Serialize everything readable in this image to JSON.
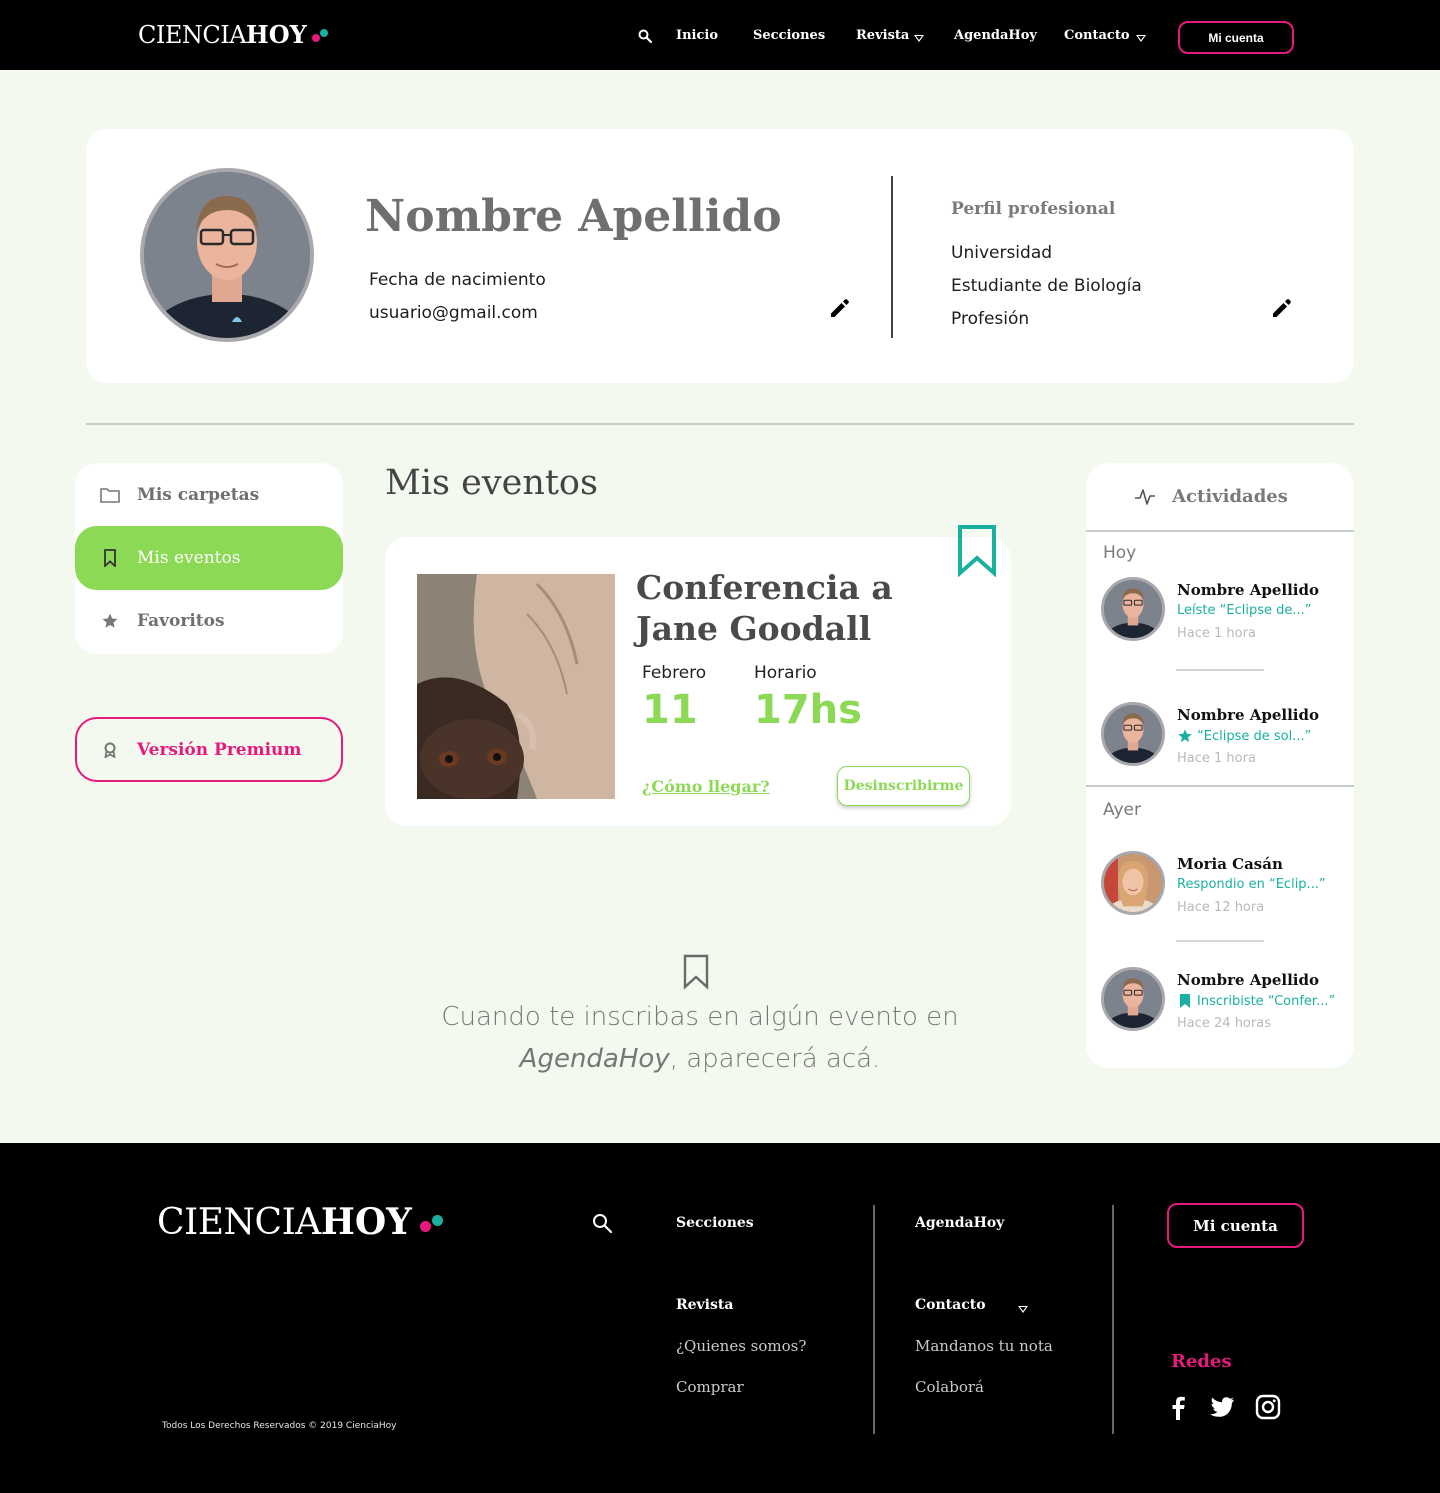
{
  "brand": {
    "name_light": "CIENCIA",
    "name_bold": "HOY",
    "colors": {
      "pink": "#e8197d",
      "teal": "#1ab0a0",
      "green": "#8cd955"
    }
  },
  "header": {
    "nav": [
      "Inicio",
      "Secciones",
      "Revista",
      "AgendaHoy",
      "Contacto"
    ],
    "account_button": "Mi cuenta",
    "icons": {
      "search": "search-icon",
      "dropdown": "triangle-down-icon"
    }
  },
  "profile": {
    "name": "Nombre Apellido",
    "birthdate": "Fecha de nacimiento",
    "email": "usuario@gmail.com",
    "pro_title": "Perfil profesional",
    "pro_lines": [
      "Universidad",
      "Estudiante de Biología",
      "Profesión"
    ]
  },
  "sidebar": {
    "items": [
      {
        "label": "Mis carpetas",
        "icon": "folder-icon"
      },
      {
        "label": "Mis eventos",
        "icon": "bookmark-icon",
        "active": true
      },
      {
        "label": "Favoritos",
        "icon": "star-icon"
      }
    ],
    "premium": "Versión Premium"
  },
  "events": {
    "title": "Mis eventos",
    "card": {
      "title": "Conferencia a Jane Goodall",
      "month_label": "Febrero",
      "day": "11",
      "time_label": "Horario",
      "time": "17hs",
      "link": "¿Cómo llegar?",
      "button": "Desinscribirme"
    },
    "empty": {
      "line1": "Cuando te inscribas en algún evento en",
      "brand": "AgendaHoy",
      "line2_rest": ", aparecerá acá."
    }
  },
  "activities": {
    "title": "Actividades",
    "groups": [
      {
        "day": "Hoy",
        "items": [
          {
            "name": "Nombre Apellido",
            "desc": "Leíste “Eclipse de...”",
            "time": "Hace 1 hora",
            "icon": ""
          },
          {
            "name": "Nombre Apellido",
            "desc": "“Eclipse de sol...”",
            "time": "Hace 1 hora",
            "icon": "star-icon"
          }
        ]
      },
      {
        "day": "Ayer",
        "items": [
          {
            "name": "Moria Casán",
            "desc": "Respondio en “Eclip...”",
            "time": "Hace 12 hora",
            "icon": ""
          },
          {
            "name": "Nombre Apellido",
            "desc": "Inscribiste “Confer...”",
            "time": "Hace 24 horas",
            "icon": "bookmark-icon"
          }
        ]
      }
    ]
  },
  "footer": {
    "col1": [
      "Secciones",
      "Revista",
      "¿Quienes somos?",
      "Comprar"
    ],
    "col2": [
      "AgendaHoy",
      "Contacto",
      "Mandanos tu nota",
      "Colaborá"
    ],
    "account_button": "Mi cuenta",
    "social_title": "Redes",
    "social": [
      "facebook-icon",
      "twitter-icon",
      "instagram-icon"
    ],
    "copyright": "Todos Los Derechos Reservados © 2019 CienciaHoy"
  }
}
